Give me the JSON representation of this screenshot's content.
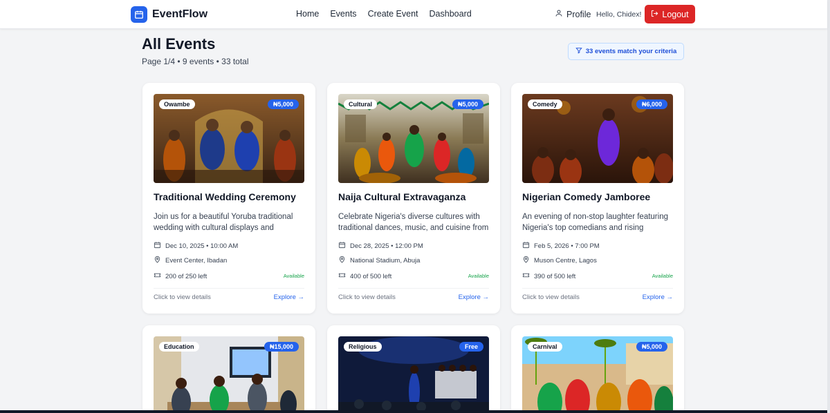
{
  "app": {
    "name": "EventFlow"
  },
  "nav": {
    "links": [
      "Home",
      "Events",
      "Create Event",
      "Dashboard"
    ],
    "profile": "Profile",
    "greeting": "Hello, Chidex!",
    "logout": "Logout"
  },
  "page": {
    "title": "All Events",
    "meta": "Page 1/4 • 9 events • 33 total",
    "criteria": "33 events match your criteria"
  },
  "common": {
    "click_hint": "Click to view details",
    "explore": "Explore →",
    "available": "Available"
  },
  "events": [
    {
      "category": "Owambe",
      "price": "₦5,000",
      "title": "Traditional Wedding Ceremony",
      "description": "Join us for a beautiful Yoruba traditional wedding with cultural displays and",
      "datetime": "Dec 10, 2025 • 10:00 AM",
      "location": "Event Center, Ibadan",
      "seats": "200 of 250 left"
    },
    {
      "category": "Cultural",
      "price": "₦5,000",
      "title": "Naija Cultural Extravaganza",
      "description": "Celebrate Nigeria's diverse cultures with traditional dances, music, and cuisine from",
      "datetime": "Dec 28, 2025 • 12:00 PM",
      "location": "National Stadium, Abuja",
      "seats": "400 of 500 left"
    },
    {
      "category": "Comedy",
      "price": "₦6,000",
      "title": "Nigerian Comedy Jamboree",
      "description": "An evening of non-stop laughter featuring Nigeria's top comedians and rising comedy",
      "datetime": "Feb 5, 2026 • 7:00 PM",
      "location": "Muson Centre, Lagos",
      "seats": "390 of 500 left"
    },
    {
      "category": "Education",
      "price": "₦15,000"
    },
    {
      "category": "Religious",
      "price": "Free"
    },
    {
      "category": "Carnival",
      "price": "₦5,000"
    }
  ],
  "colors": {
    "accent": "#2563eb",
    "logout": "#dc2626",
    "available": "#16a34a"
  }
}
